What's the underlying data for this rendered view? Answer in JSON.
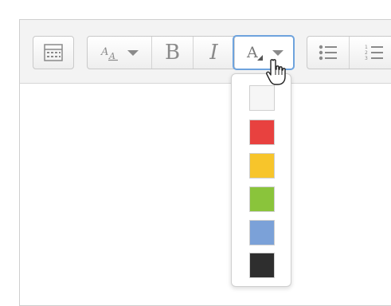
{
  "toolbar": {
    "buttons": [
      {
        "name": "toggle-toolbar-button",
        "icon": "toolbar-toggle-icon"
      },
      {
        "name": "font-size-button",
        "icon": "font-size-icon"
      },
      {
        "name": "bold-button",
        "label": "B",
        "icon": "bold-icon"
      },
      {
        "name": "italic-button",
        "label": "I",
        "icon": "italic-icon"
      },
      {
        "name": "font-color-button",
        "icon": "font-color-icon",
        "state": "active"
      },
      {
        "name": "bullet-list-button",
        "icon": "bullet-list-icon"
      },
      {
        "name": "numbered-list-button",
        "icon": "numbered-list-icon"
      }
    ]
  },
  "color_menu": {
    "swatches": [
      {
        "name": "white",
        "color": "#f6f6f6"
      },
      {
        "name": "red",
        "color": "#e8413f"
      },
      {
        "name": "yellow",
        "color": "#f7c52b"
      },
      {
        "name": "green",
        "color": "#8ac43b"
      },
      {
        "name": "blue",
        "color": "#7ba1d8"
      },
      {
        "name": "black",
        "color": "#2e2e2e"
      }
    ]
  },
  "colors": {
    "accent_focus": "#6ea3dd",
    "icon_gray": "#8a8a8a",
    "toolbar_bg": "#f3f3f3"
  }
}
